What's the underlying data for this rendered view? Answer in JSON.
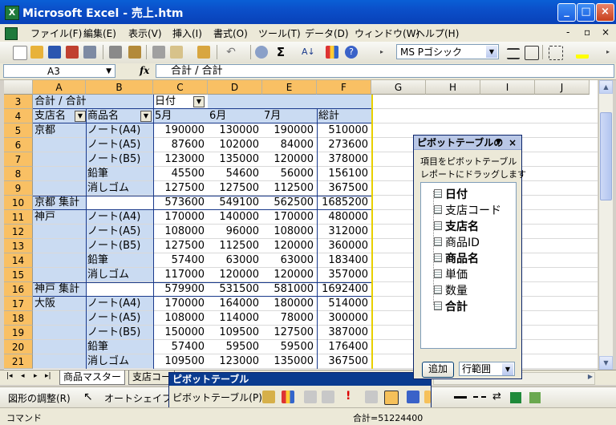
{
  "window": {
    "title": "Microsoft Excel - 売上.htm",
    "app_icon": "X"
  },
  "menu": [
    "ファイル(F)",
    "編集(E)",
    "表示(V)",
    "挿入(I)",
    "書式(O)",
    "ツール(T)",
    "データ(D)",
    "ウィンドウ(W)",
    "ヘルプ(H)"
  ],
  "menu_right": {
    "min": "_",
    "restore": "🗗",
    "close": "×"
  },
  "font_name": "MS Pゴシック",
  "name_box": "A3",
  "fx_label": "fx",
  "formula": "合計 / 合計",
  "col_headers": [
    "A",
    "B",
    "C",
    "D",
    "E",
    "F",
    "G",
    "H",
    "I",
    "J"
  ],
  "row_headers": [
    "3",
    "4",
    "5",
    "6",
    "7",
    "8",
    "9",
    "10",
    "11",
    "12",
    "13",
    "14",
    "15",
    "16",
    "17",
    "18",
    "19",
    "20",
    "21"
  ],
  "pivot": {
    "r3": {
      "a": "合計 / 合計",
      "c": "日付"
    },
    "r4": {
      "a": "支店名",
      "b": "商品名",
      "c": "5月",
      "d": "6月",
      "e": "7月",
      "f": "総計"
    },
    "rows": [
      {
        "a": "京都",
        "b": "ノート(A4)",
        "c": "190000",
        "d": "130000",
        "e": "190000",
        "f": "510000"
      },
      {
        "a": "",
        "b": "ノート(A5)",
        "c": "87600",
        "d": "102000",
        "e": "84000",
        "f": "273600"
      },
      {
        "a": "",
        "b": "ノート(B5)",
        "c": "123000",
        "d": "135000",
        "e": "120000",
        "f": "378000"
      },
      {
        "a": "",
        "b": "鉛筆",
        "c": "45500",
        "d": "54600",
        "e": "56000",
        "f": "156100"
      },
      {
        "a": "",
        "b": "消しゴム",
        "c": "127500",
        "d": "127500",
        "e": "112500",
        "f": "367500"
      },
      {
        "a": "京都 集計",
        "b": "",
        "c": "573600",
        "d": "549100",
        "e": "562500",
        "f": "1685200"
      },
      {
        "a": "神戸",
        "b": "ノート(A4)",
        "c": "170000",
        "d": "140000",
        "e": "170000",
        "f": "480000"
      },
      {
        "a": "",
        "b": "ノート(A5)",
        "c": "108000",
        "d": "96000",
        "e": "108000",
        "f": "312000"
      },
      {
        "a": "",
        "b": "ノート(B5)",
        "c": "127500",
        "d": "112500",
        "e": "120000",
        "f": "360000"
      },
      {
        "a": "",
        "b": "鉛筆",
        "c": "57400",
        "d": "63000",
        "e": "63000",
        "f": "183400"
      },
      {
        "a": "",
        "b": "消しゴム",
        "c": "117000",
        "d": "120000",
        "e": "120000",
        "f": "357000"
      },
      {
        "a": "神戸 集計",
        "b": "",
        "c": "579900",
        "d": "531500",
        "e": "581000",
        "f": "1692400"
      },
      {
        "a": "大阪",
        "b": "ノート(A4)",
        "c": "170000",
        "d": "164000",
        "e": "180000",
        "f": "514000"
      },
      {
        "a": "",
        "b": "ノート(A5)",
        "c": "108000",
        "d": "114000",
        "e": "78000",
        "f": "300000"
      },
      {
        "a": "",
        "b": "ノート(B5)",
        "c": "150000",
        "d": "109500",
        "e": "127500",
        "f": "387000"
      },
      {
        "a": "",
        "b": "鉛筆",
        "c": "57400",
        "d": "59500",
        "e": "59500",
        "f": "176400"
      },
      {
        "a": "",
        "b": "消しゴム",
        "c": "109500",
        "d": "123000",
        "e": "135000",
        "f": "367500"
      }
    ]
  },
  "sheet_tabs": [
    "商品マスター",
    "支店コー"
  ],
  "field_list": {
    "title": "ピボットテーブルの",
    "instruction_line1": "項目をピボットテーブル",
    "instruction_line2": "レポートにドラッグします",
    "fields": [
      {
        "label": "日付",
        "bold": true
      },
      {
        "label": "支店コード",
        "bold": false
      },
      {
        "label": "支店名",
        "bold": true
      },
      {
        "label": "商品ID",
        "bold": false
      },
      {
        "label": "商品名",
        "bold": true
      },
      {
        "label": "単価",
        "bold": false
      },
      {
        "label": "数量",
        "bold": false
      },
      {
        "label": "合計",
        "bold": true
      }
    ],
    "add_button": "追加",
    "area_select": "行範囲"
  },
  "pivot_toolbar": {
    "title": "ピボットテーブル",
    "menu": "ピボットテーブル(P)"
  },
  "draw_toolbar": {
    "adjust": "図形の調整(R)",
    "autoshape": "オートシェイプ(U)"
  },
  "status": {
    "left": "コマンド",
    "sum": "合計=51224400"
  }
}
